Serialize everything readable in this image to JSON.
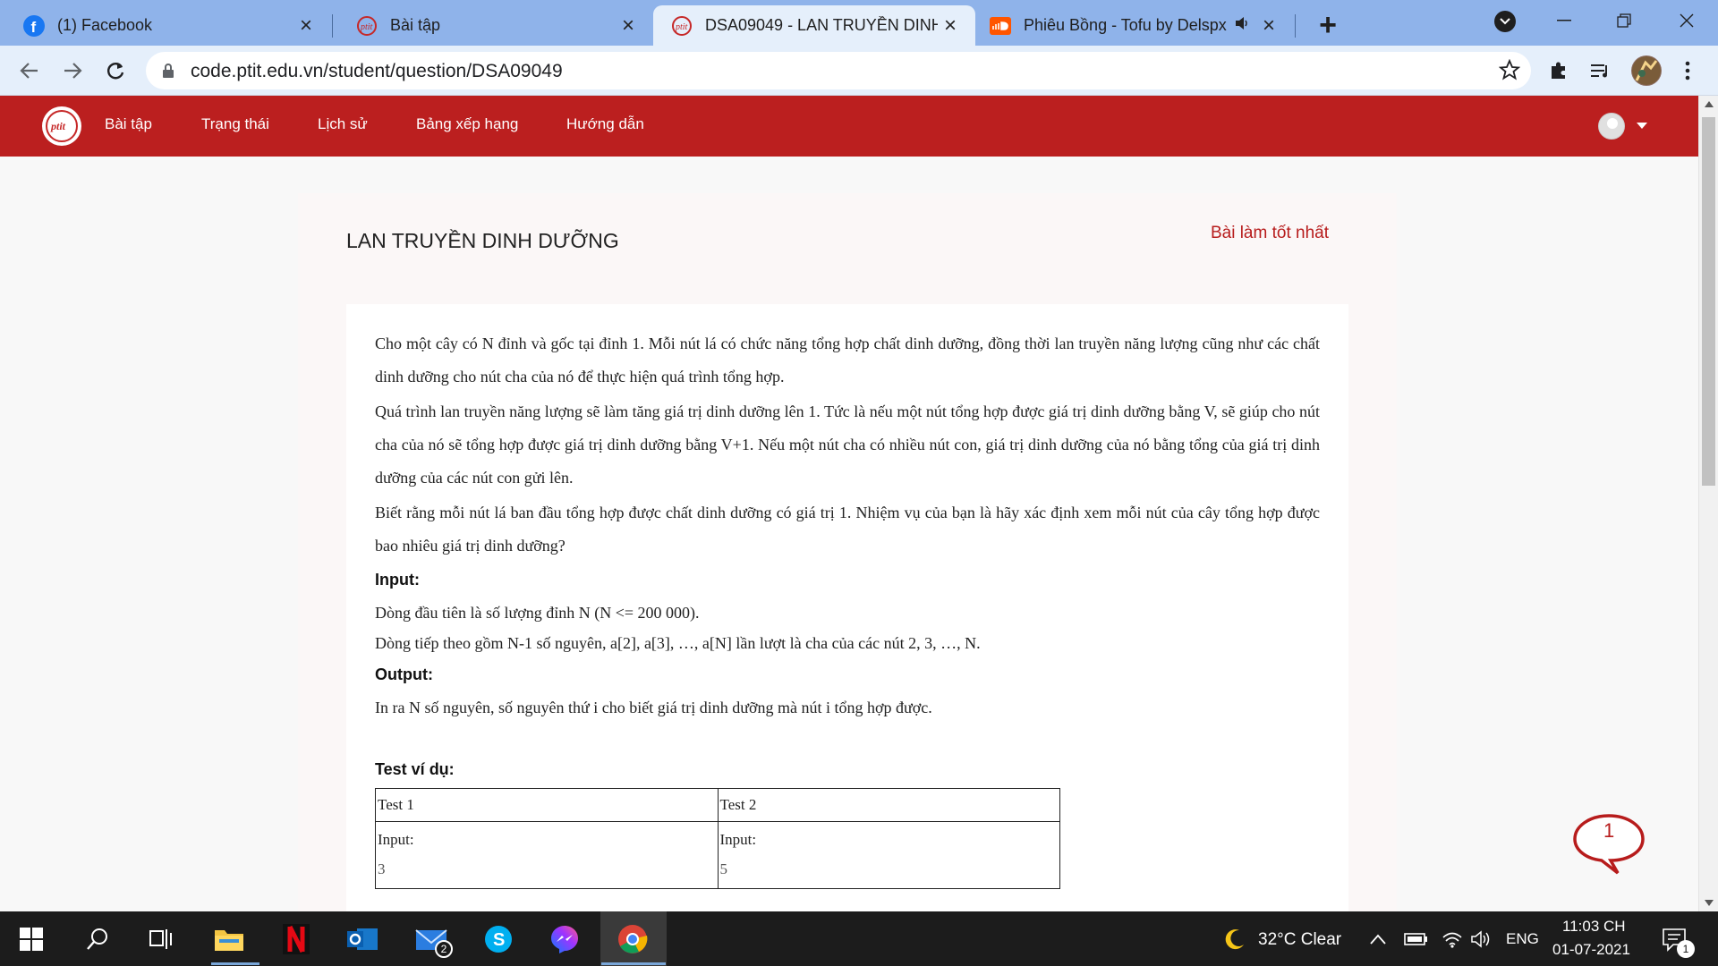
{
  "browser": {
    "tabs": [
      {
        "title": "(1) Facebook",
        "icon": "facebook-icon",
        "active": false
      },
      {
        "title": "Bài tập",
        "icon": "ptit-icon",
        "active": false
      },
      {
        "title": "DSA09049 - LAN TRUYỀN DINH",
        "icon": "ptit-icon",
        "active": true
      },
      {
        "title": "Phiêu Bồng - Tofu by Delspx",
        "icon": "soundcloud-icon",
        "active": false
      }
    ],
    "url": "code.ptit.edu.vn/student/question/DSA09049"
  },
  "site": {
    "nav": [
      "Bài tập",
      "Trạng thái",
      "Lịch sử",
      "Bảng xếp hạng",
      "Hướng dẫn"
    ]
  },
  "problem": {
    "title": "LAN TRUYỀN DINH DƯỠNG",
    "best_link": "Bài làm tốt nhất",
    "paragraphs": [
      "Cho một cây có N đỉnh và gốc tại đỉnh 1. Mỗi nút lá có chức năng tổng hợp chất dinh dưỡng, đồng thời lan truyền năng lượng cũng như các chất dinh dưỡng cho nút cha của nó để thực hiện quá trình tổng hợp.",
      "Quá trình lan truyền năng lượng sẽ làm tăng giá trị dinh dưỡng lên 1. Tức là nếu một nút tổng hợp được giá trị dinh dưỡng bằng V, sẽ giúp cho nút cha của nó sẽ tổng hợp được giá trị dinh dưỡng bằng V+1. Nếu một nút cha có nhiều nút con, giá trị dinh dưỡng của nó bằng tổng của giá trị dinh dưỡng của các nút con gửi lên.",
      "Biết rằng mỗi nút lá ban đầu tổng hợp được chất dinh dưỡng có giá trị 1. Nhiệm vụ của bạn là hãy xác định xem mỗi nút của cây tổng hợp được bao nhiêu giá trị dinh dưỡng?"
    ],
    "input_heading": "Input:",
    "input_lines": [
      "Dòng đầu tiên là số lượng đỉnh N (N <= 200 000).",
      "Dòng tiếp theo gồm N-1 số nguyên, a[2], a[3], …, a[N] lần lượt là cha của các nút 2, 3, …, N."
    ],
    "output_heading": "Output:",
    "output_lines": [
      "In ra N số nguyên, số nguyên thứ i cho biết giá trị dinh dưỡng mà nút i tổng hợp được."
    ],
    "examples_heading": "Test ví dụ:",
    "tests": [
      {
        "name": "Test 1",
        "input_label": "Input:",
        "first_value": "3"
      },
      {
        "name": "Test 2",
        "input_label": "Input:",
        "first_value": "5"
      }
    ]
  },
  "chat": {
    "count": "1"
  },
  "taskbar": {
    "weather": "32°C  Clear",
    "language": "ENG",
    "time": "11:03 CH",
    "date": "01-07-2021",
    "mail_badge": "2",
    "notification_badge": "1"
  },
  "colors": {
    "brand_red": "#bb1f1f",
    "tab_strip": "#8fb3ea",
    "active_tab": "#e5effb"
  }
}
